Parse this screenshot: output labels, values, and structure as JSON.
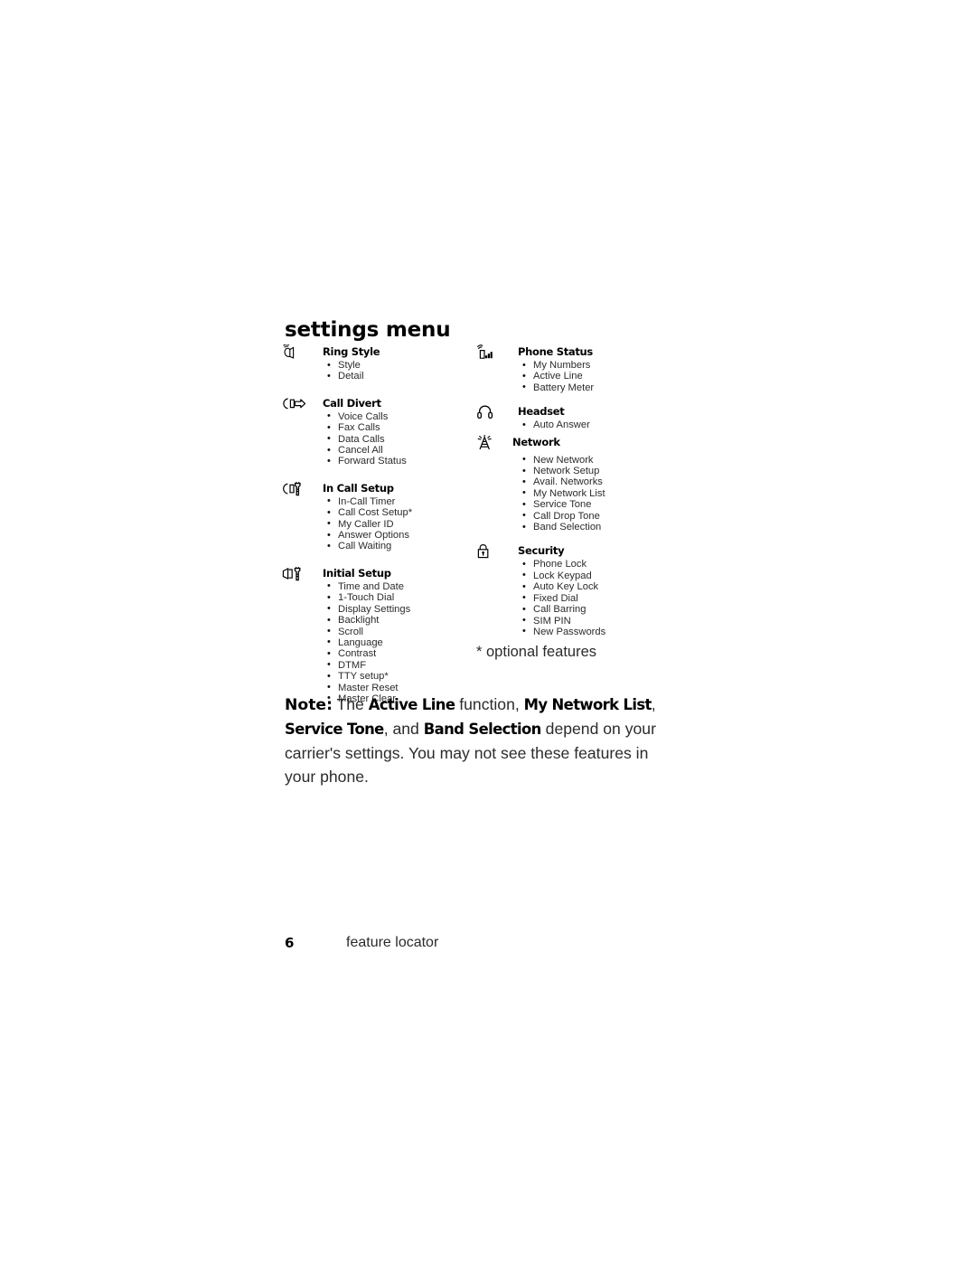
{
  "page": {
    "title": "settings menu",
    "optional_features_note": "* optional features"
  },
  "menu": {
    "left_column": [
      {
        "icon": "ring-style-icon",
        "title": "Ring Style",
        "items": [
          "Style",
          "Detail"
        ]
      },
      {
        "icon": "call-divert-icon",
        "title": "Call Divert",
        "items": [
          "Voice Calls",
          "Fax Calls",
          "Data Calls",
          "Cancel All",
          "Forward Status"
        ]
      },
      {
        "icon": "in-call-setup-icon",
        "title": "In Call Setup",
        "items": [
          "In-Call Timer",
          "Call Cost Setup*",
          "My Caller ID",
          "Answer Options",
          "Call Waiting"
        ]
      },
      {
        "icon": "initial-setup-icon",
        "title": "Initial Setup",
        "items": [
          "Time and Date",
          "1-Touch Dial",
          "Display Settings",
          "Backlight",
          "Scroll",
          "Language",
          "Contrast",
          "DTMF",
          "TTY setup*",
          "Master Reset",
          "Master Clear"
        ]
      }
    ],
    "right_column": [
      {
        "icon": "phone-status-icon",
        "title": "Phone Status",
        "items": [
          "My Numbers",
          "Active Line",
          "Battery Meter"
        ]
      },
      {
        "icon": "headset-icon",
        "title": "Headset",
        "items": [
          "Auto Answer"
        ]
      },
      {
        "icon": "network-icon",
        "title": "Network",
        "items": [
          "New Network",
          "Network Setup",
          "Avail. Networks",
          "My Network List",
          "Service Tone",
          "Call Drop Tone",
          "Band Selection"
        ]
      },
      {
        "icon": "security-icon",
        "title": "Security",
        "items": [
          "Phone Lock",
          "Lock Keypad",
          "Auto Key Lock",
          "Fixed Dial",
          "Call Barring",
          "SIM PIN",
          "New Passwords"
        ]
      }
    ]
  },
  "note": {
    "label": "Note:",
    "text_1": " The ",
    "feature_1": "Active Line",
    "text_2": " function, ",
    "feature_2": "My Network List",
    "text_3": ", ",
    "feature_3": "Service Tone",
    "text_4": ", and ",
    "feature_4": "Band Selection",
    "text_5": " depend on your carrier's settings. You may not see these features in your phone."
  },
  "footer": {
    "page_number": "6",
    "section_label": "feature locator"
  },
  "colors": {
    "text": "#2b2b2b",
    "heading": "#000000",
    "background": "#ffffff"
  }
}
